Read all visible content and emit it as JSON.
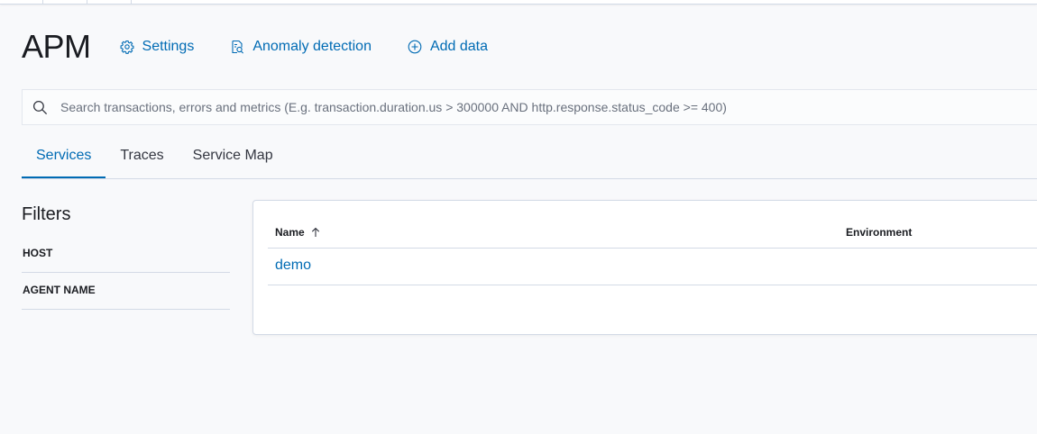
{
  "header": {
    "title": "APM",
    "links": {
      "settings": "Settings",
      "anomaly": "Anomaly detection",
      "add_data": "Add data"
    }
  },
  "search": {
    "placeholder": "Search transactions, errors and metrics (E.g. transaction.duration.us > 300000 AND http.response.status_code >= 400)"
  },
  "tabs": [
    "Services",
    "Traces",
    "Service Map"
  ],
  "active_tab": "Services",
  "filters": {
    "title": "Filters",
    "items": [
      "HOST",
      "AGENT NAME"
    ]
  },
  "table": {
    "columns": {
      "name": "Name",
      "environment": "Environment"
    },
    "sort": {
      "column": "Name",
      "direction": "ascending"
    },
    "rows": [
      {
        "name": "demo",
        "environment": ""
      }
    ]
  },
  "colors": {
    "link": "#006bb4",
    "text": "#343741",
    "border": "#d3dae6",
    "background": "#f8f9fb"
  }
}
